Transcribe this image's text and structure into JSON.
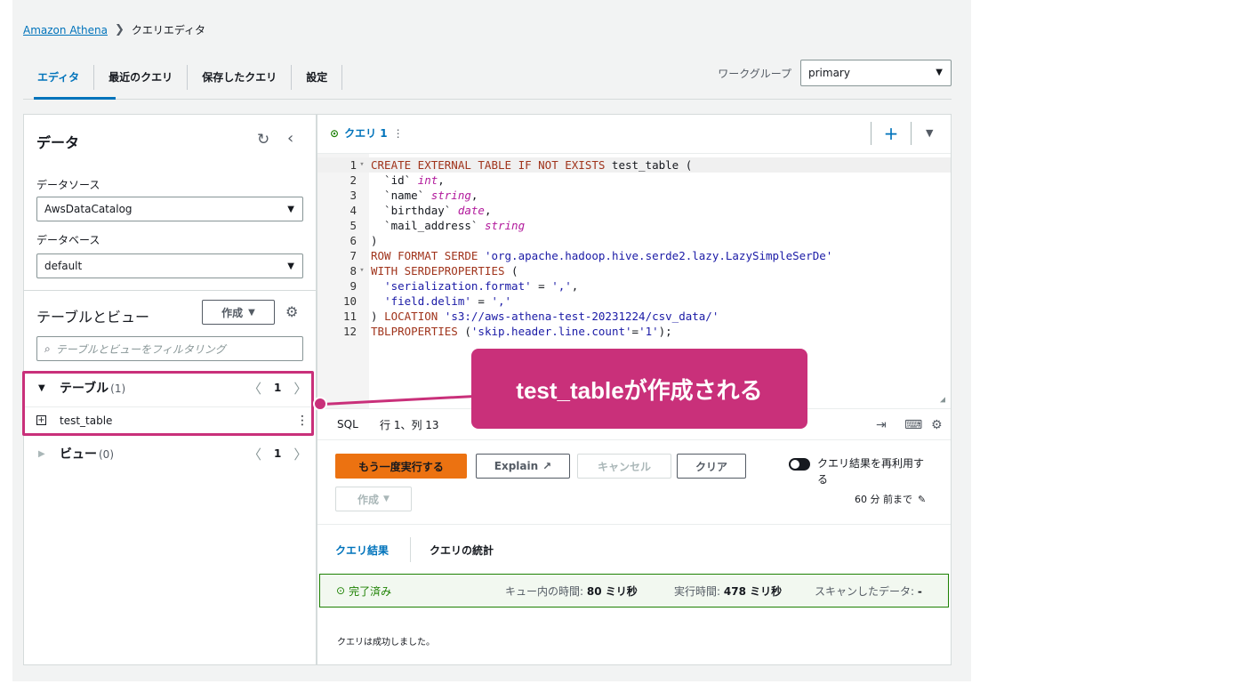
{
  "breadcrumb": {
    "root": "Amazon Athena",
    "separator": "❯",
    "current": "クエリエディタ"
  },
  "nav": {
    "tabs": [
      "エディタ",
      "最近のクエリ",
      "保存したクエリ",
      "設定"
    ],
    "workgroup_label": "ワークグループ",
    "workgroup_value": "primary"
  },
  "left": {
    "title": "データ",
    "datasource_label": "データソース",
    "datasource_value": "AwsDataCatalog",
    "database_label": "データベース",
    "database_value": "default",
    "tv_title": "テーブルとビュー",
    "create_label": "作成",
    "filter_placeholder": "テーブルとビューをフィルタリング",
    "tables_label": "テーブル",
    "tables_count": "(1)",
    "tables_page": "1",
    "table_name": "test_table",
    "views_label": "ビュー",
    "views_count": "(0)",
    "views_page": "1"
  },
  "query_tab": {
    "name": "クエリ 1"
  },
  "editor": {
    "lines": [
      "1",
      "2",
      "3",
      "4",
      "5",
      "6",
      "7",
      "8",
      "9",
      "10",
      "11",
      "12"
    ]
  },
  "statusbar": {
    "lang": "SQL",
    "position": "行 1、列 13"
  },
  "actions": {
    "run_again": "もう一度実行する",
    "explain": "Explain",
    "cancel": "キャンセル",
    "clear": "クリア",
    "create": "作成",
    "reuse_label": "クエリ結果を再利用する",
    "reuse_time": "60 分 前まで"
  },
  "results": {
    "tab_results": "クエリ結果",
    "tab_stats": "クエリの統計",
    "status": "完了済み",
    "queue_label": "キュー内の時間:",
    "queue_value": "80 ミリ秒",
    "exec_label": "実行時間:",
    "exec_value": "478 ミリ秒",
    "scan_label": "スキャンしたデータ:",
    "scan_value": "-",
    "message": "クエリは成功しました。"
  },
  "annotation": {
    "text": "test_tableが作成される"
  },
  "colors": {
    "accent": "#0073bb",
    "primary_button": "#ec7211",
    "success": "#1d8102",
    "annotation": "#c9307a"
  }
}
